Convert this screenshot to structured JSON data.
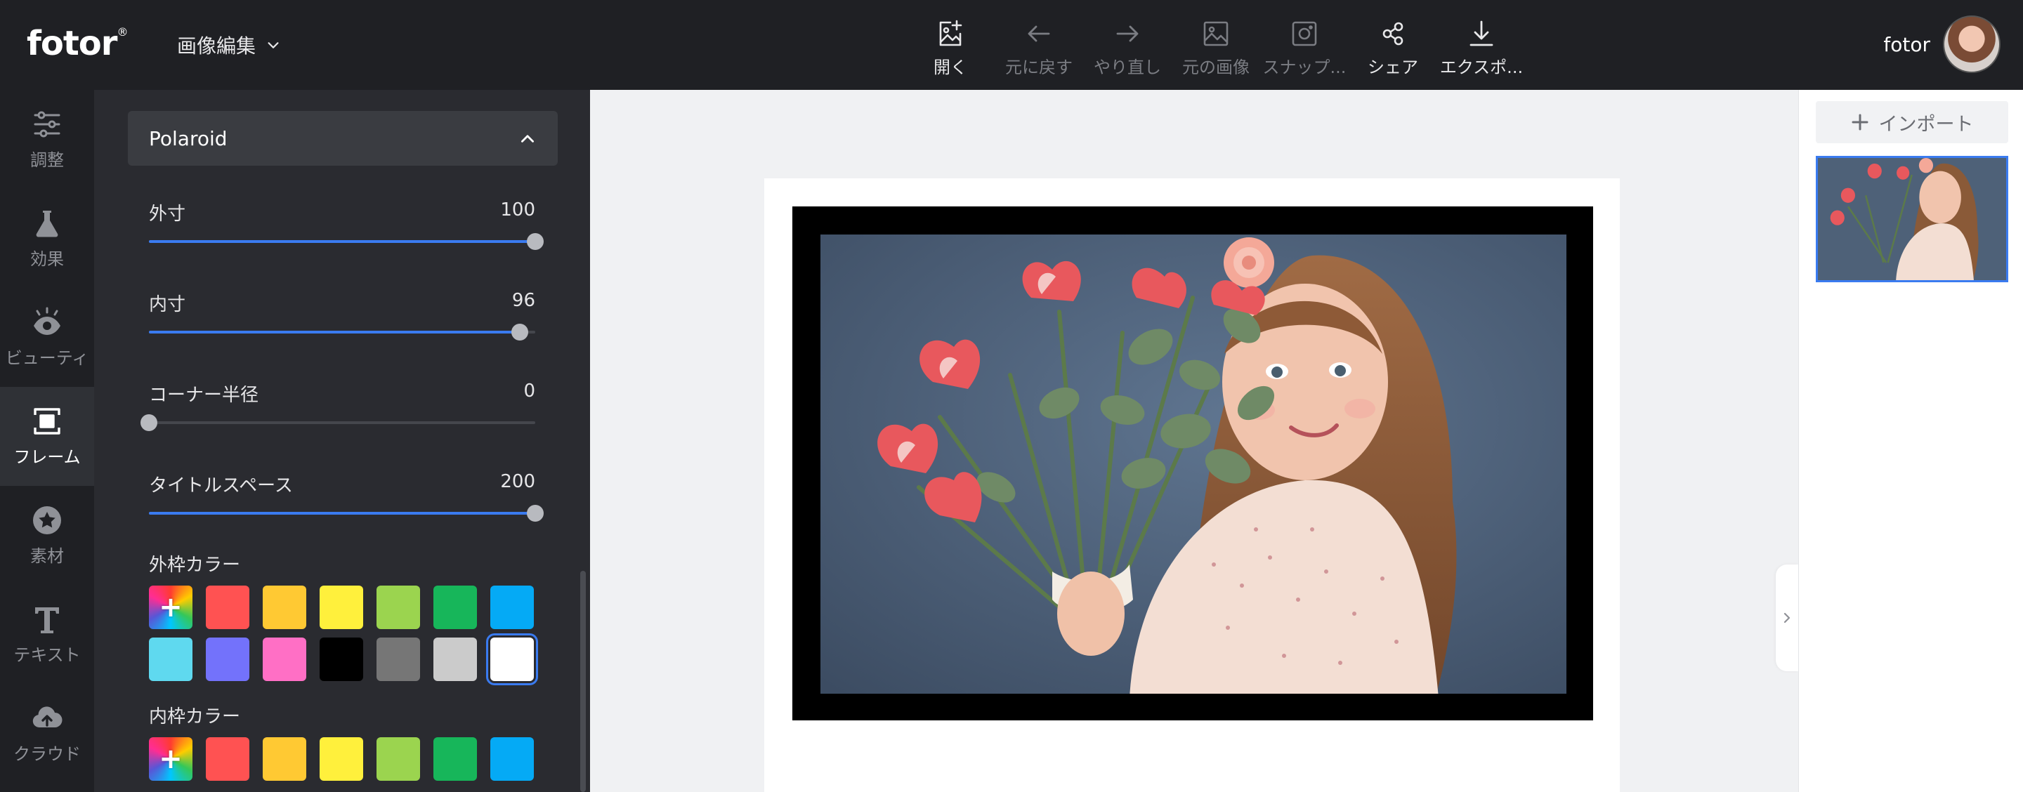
{
  "app": {
    "logo_text": "fotor",
    "logo_mark": "®",
    "mode_label": "画像編集"
  },
  "toolbar": {
    "items": [
      {
        "label": "開く",
        "icon": "open-image-icon",
        "enabled": true
      },
      {
        "label": "元に戻す",
        "icon": "undo-arrow-icon",
        "enabled": false
      },
      {
        "label": "やり直し",
        "icon": "redo-arrow-icon",
        "enabled": false
      },
      {
        "label": "元の画像",
        "icon": "original-image-icon",
        "enabled": false
      },
      {
        "label": "スナップ...",
        "icon": "snapshot-icon",
        "enabled": false
      },
      {
        "label": "シェア",
        "icon": "share-icon",
        "enabled": true
      },
      {
        "label": "エクスポ...",
        "icon": "download-icon",
        "enabled": true
      }
    ]
  },
  "user": {
    "name": "fotor"
  },
  "rail": {
    "items": [
      {
        "label": "調整",
        "icon": "sliders-icon",
        "active": false
      },
      {
        "label": "効果",
        "icon": "flask-icon",
        "active": false
      },
      {
        "label": "ビューティ",
        "icon": "eye-icon",
        "active": false
      },
      {
        "label": "フレーム",
        "icon": "frame-icon",
        "active": true
      },
      {
        "label": "素材",
        "icon": "star-badge-icon",
        "active": false
      },
      {
        "label": "テキスト",
        "icon": "text-t-icon",
        "active": false
      },
      {
        "label": "クラウド",
        "icon": "cloud-upload-icon",
        "active": false
      }
    ]
  },
  "panel": {
    "header": "Polaroid",
    "sliders": [
      {
        "label": "外寸",
        "value": "100",
        "fraction": 1.0
      },
      {
        "label": "内寸",
        "value": "96",
        "fraction": 0.96
      },
      {
        "label": "コーナー半径",
        "value": "0",
        "fraction": 0.0
      },
      {
        "label": "タイトルスペース",
        "value": "200",
        "fraction": 1.0
      }
    ],
    "outer_color_title": "外枠カラー",
    "inner_color_title": "内枠カラー",
    "outer_colors": [
      "#ff5252",
      "#ffc933",
      "#fff03c",
      "#9bd44f",
      "#17b65a",
      "#05aaf5",
      "#5fd9ef",
      "#7372fb",
      "#ff6fc5",
      "#000000",
      "#767676",
      "#cbcbcb",
      "#ffffff"
    ],
    "outer_selected": "#ffffff",
    "inner_colors": [
      "#ff5252",
      "#ffc933",
      "#fff03c",
      "#9bd44f",
      "#17b65a",
      "#05aaf5"
    ],
    "plus_glyph": "+"
  },
  "right_panel": {
    "import_label": "インポート"
  }
}
